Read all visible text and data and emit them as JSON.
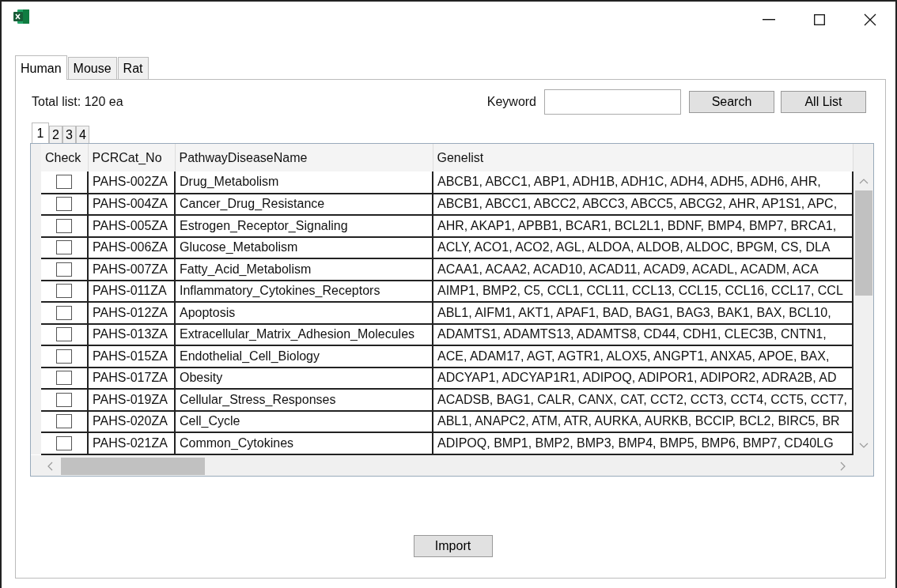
{
  "species_tabs": [
    {
      "label": "Human",
      "selected": true
    },
    {
      "label": "Mouse",
      "selected": false
    },
    {
      "label": "Rat",
      "selected": false
    }
  ],
  "total_label": "Total list: 120 ea",
  "keyword": {
    "label": "Keyword"
  },
  "buttons": [
    "Search",
    "All List"
  ],
  "page_tabs": [
    {
      "label": "1",
      "selected": true
    },
    {
      "label": "2",
      "selected": false
    },
    {
      "label": "3",
      "selected": false
    },
    {
      "label": "4",
      "selected": false
    }
  ],
  "table": {
    "columns": [
      "Check",
      "PCRCat_No",
      "PathwayDiseaseName",
      "Genelist"
    ],
    "rows": [
      {
        "checked": false,
        "cat_no": "PAHS-002ZA",
        "name": "Drug_Metabolism",
        "genes": "ABCB1, ABCC1, ABP1, ADH1B, ADH1C, ADH4, ADH5, ADH6, AHR,"
      },
      {
        "checked": false,
        "cat_no": "PAHS-004ZA",
        "name": "Cancer_Drug_Resistance",
        "genes": "ABCB1, ABCC1, ABCC2, ABCC3, ABCC5, ABCG2, AHR, AP1S1, APC,"
      },
      {
        "checked": false,
        "cat_no": "PAHS-005ZA",
        "name": "Estrogen_Receptor_Signaling",
        "genes": "AHR, AKAP1, APBB1, BCAR1, BCL2L1, BDNF, BMP4, BMP7, BRCA1,"
      },
      {
        "checked": false,
        "cat_no": "PAHS-006ZA",
        "name": "Glucose_Metabolism",
        "genes": "ACLY, ACO1, ACO2, AGL, ALDOA, ALDOB, ALDOC, BPGM, CS, DLA"
      },
      {
        "checked": false,
        "cat_no": "PAHS-007ZA",
        "name": "Fatty_Acid_Metabolism",
        "genes": "ACAA1, ACAA2, ACAD10, ACAD11, ACAD9, ACADL, ACADM, ACA"
      },
      {
        "checked": false,
        "cat_no": "PAHS-011ZA",
        "name": "Inflammatory_Cytokines_Receptors",
        "genes": "AIMP1, BMP2, C5, CCL1, CCL11, CCL13, CCL15, CCL16, CCL17, CCL"
      },
      {
        "checked": false,
        "cat_no": "PAHS-012ZA",
        "name": "Apoptosis",
        "genes": "ABL1, AIFM1, AKT1, APAF1, BAD, BAG1, BAG3, BAK1, BAX, BCL10,"
      },
      {
        "checked": false,
        "cat_no": "PAHS-013ZA",
        "name": "Extracellular_Matrix_Adhesion_Molecules",
        "genes": "ADAMTS1, ADAMTS13, ADAMTS8, CD44, CDH1, CLEC3B, CNTN1,"
      },
      {
        "checked": false,
        "cat_no": "PAHS-015ZA",
        "name": "Endothelial_Cell_Biology",
        "genes": "ACE, ADAM17, AGT, AGTR1, ALOX5, ANGPT1, ANXA5, APOE, BAX,"
      },
      {
        "checked": false,
        "cat_no": "PAHS-017ZA",
        "name": "Obesity",
        "genes": "ADCYAP1, ADCYAP1R1, ADIPOQ, ADIPOR1, ADIPOR2, ADRA2B, AD"
      },
      {
        "checked": false,
        "cat_no": "PAHS-019ZA",
        "name": "Cellular_Stress_Responses",
        "genes": "ACADSB, BAG1, CALR, CANX, CAT, CCT2, CCT3, CCT4, CCT5, CCT7,"
      },
      {
        "checked": false,
        "cat_no": "PAHS-020ZA",
        "name": "Cell_Cycle",
        "genes": "ABL1, ANAPC2, ATM, ATR, AURKA, AURKB, BCCIP, BCL2, BIRC5, BR"
      },
      {
        "checked": false,
        "cat_no": "PAHS-021ZA",
        "name": "Common_Cytokines",
        "genes": "ADIPOQ, BMP1, BMP2, BMP3, BMP4, BMP5, BMP6, BMP7, CD40LG"
      }
    ]
  },
  "import_button": "Import"
}
